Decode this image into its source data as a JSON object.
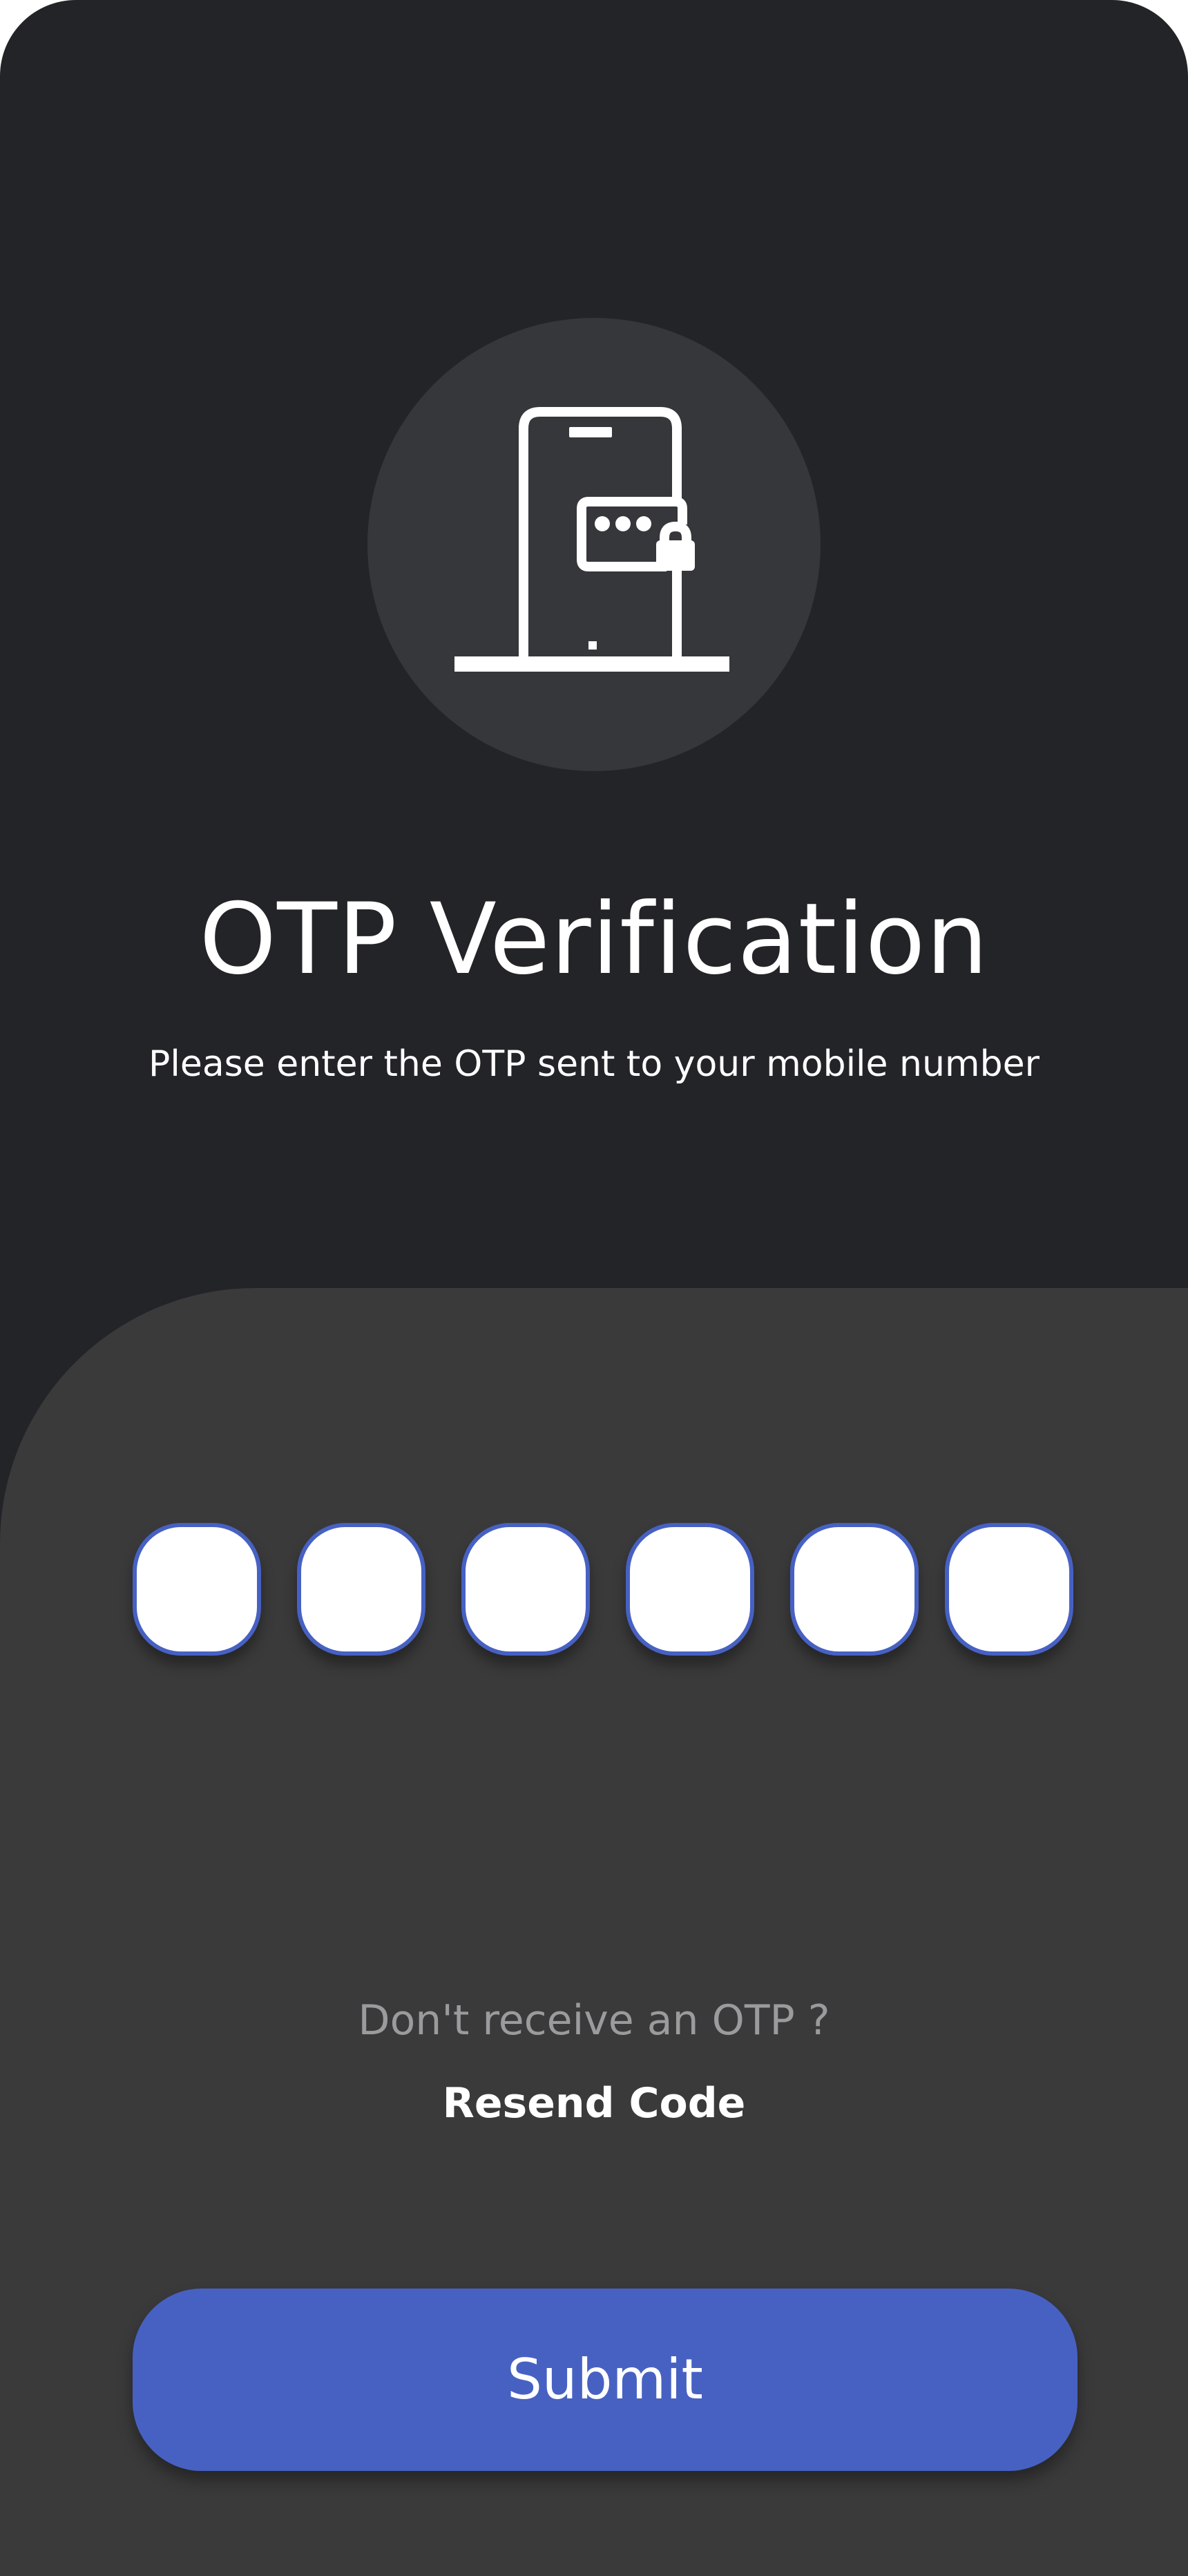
{
  "header": {
    "icon": "phone-lock-icon",
    "title": "OTP Verification",
    "subtitle": "Please enter the OTP sent to your mobile number"
  },
  "otp": {
    "digits": [
      "",
      "",
      "",
      "",
      "",
      ""
    ]
  },
  "resend": {
    "prompt": "Don't receive an OTP ?",
    "link_label": "Resend Code"
  },
  "submit": {
    "label": "Submit"
  },
  "colors": {
    "background": "#232428",
    "sheet": "#3a3a3b",
    "accent": "#4761c3",
    "icon_circle": "#36373b",
    "muted_text": "#9b9b9d"
  }
}
